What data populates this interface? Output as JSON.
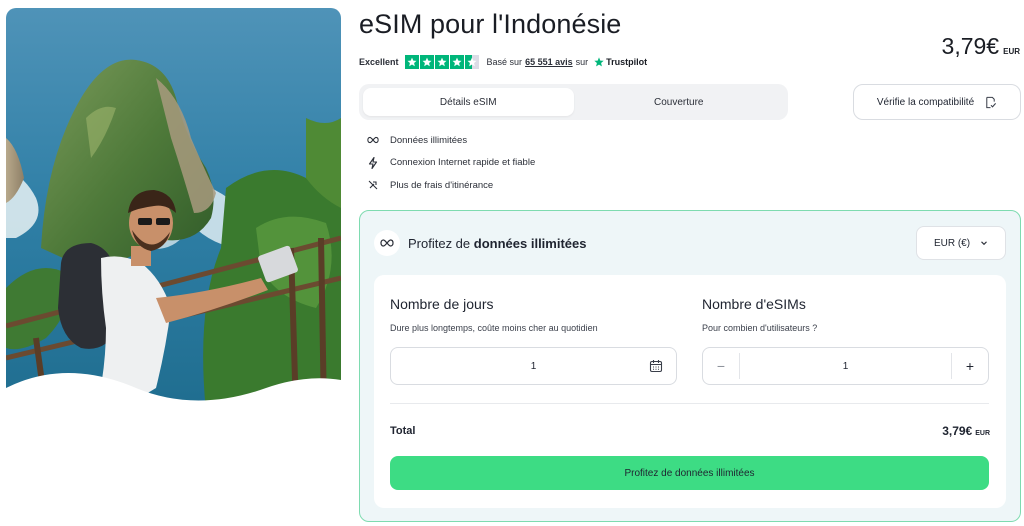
{
  "header": {
    "title": "eSIM pour l'Indonésie",
    "price": "3,79€",
    "currency": "EUR"
  },
  "rating": {
    "label": "Excellent",
    "stars": 4.5,
    "based_on": "Basé sur",
    "reviews": "65 551 avis",
    "on": "sur",
    "brand": "Trustpilot"
  },
  "tabs": [
    {
      "label": "Détails eSIM",
      "active": true
    },
    {
      "label": "Couverture",
      "active": false
    }
  ],
  "compat_button": {
    "label": "Vérifie la compatibilité",
    "icon": "check-document-icon"
  },
  "features": [
    {
      "icon": "infinity-icon",
      "label": "Données illimitées"
    },
    {
      "icon": "lightning-icon",
      "label": "Connexion Internet rapide et fiable"
    },
    {
      "icon": "no-roaming-icon",
      "label": "Plus de frais d'itinérance"
    }
  ],
  "plan": {
    "title_prefix": "Profitez de",
    "title_bold": "données illimitées",
    "currency_select": "EUR (€)",
    "days": {
      "heading": "Nombre de jours",
      "subtitle": "Dure plus longtemps, coûte moins cher au quotidien",
      "value": "1"
    },
    "esims": {
      "heading": "Nombre d'eSIMs",
      "subtitle": "Pour combien d'utilisateurs ?",
      "value": "1",
      "minus": "−",
      "plus": "+"
    },
    "total_label": "Total",
    "total_amount": "3,79€",
    "total_currency": "EUR",
    "cta": "Profitez de données illimitées"
  },
  "colors": {
    "accent_green": "#3ddc84",
    "card_border": "#7edbb0",
    "card_bg": "#eef6f8",
    "trustpilot_green": "#00b67a"
  }
}
